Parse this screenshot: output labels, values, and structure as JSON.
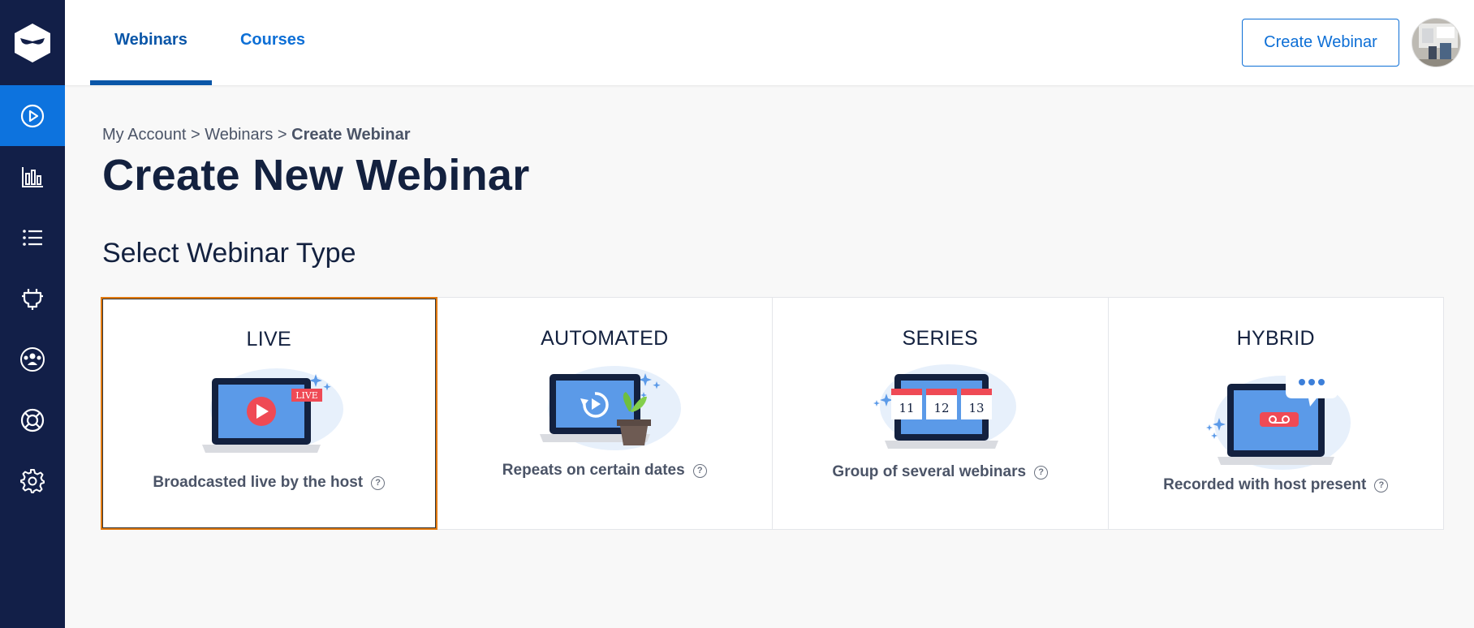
{
  "sidebar": {
    "items": [
      {
        "name": "webinars",
        "icon": "play-circle-icon",
        "active": true
      },
      {
        "name": "analytics",
        "icon": "bar-chart-icon",
        "active": false
      },
      {
        "name": "list",
        "icon": "list-icon",
        "active": false
      },
      {
        "name": "integrations",
        "icon": "plug-icon",
        "active": false
      },
      {
        "name": "team",
        "icon": "users-icon",
        "active": false
      },
      {
        "name": "support",
        "icon": "lifebuoy-icon",
        "active": false
      },
      {
        "name": "settings",
        "icon": "gear-icon",
        "active": false
      }
    ]
  },
  "header": {
    "tabs": [
      {
        "label": "Webinars",
        "active": true
      },
      {
        "label": "Courses",
        "active": false
      }
    ],
    "create_button": "Create Webinar"
  },
  "breadcrumb": {
    "items": [
      "My Account",
      "Webinars"
    ],
    "separator": ">",
    "current": "Create Webinar"
  },
  "page_title": "Create New Webinar",
  "section_title": "Select Webinar Type",
  "help_glyph": "?",
  "webinar_types": [
    {
      "title": "LIVE",
      "description": "Broadcasted live by the host",
      "badge": "LIVE",
      "selected": true
    },
    {
      "title": "AUTOMATED",
      "description": "Repeats on certain dates",
      "selected": false
    },
    {
      "title": "SERIES",
      "description": "Group of several webinars",
      "dates": [
        "11",
        "12",
        "13"
      ],
      "selected": false
    },
    {
      "title": "HYBRID",
      "description": "Recorded with host present",
      "selected": false
    }
  ],
  "colors": {
    "sidebar_bg": "#121f48",
    "accent": "#0d73de",
    "selected_border": "#e27a10",
    "illustration_blue": "#5b9ae8",
    "illustration_red": "#ef4a55"
  }
}
